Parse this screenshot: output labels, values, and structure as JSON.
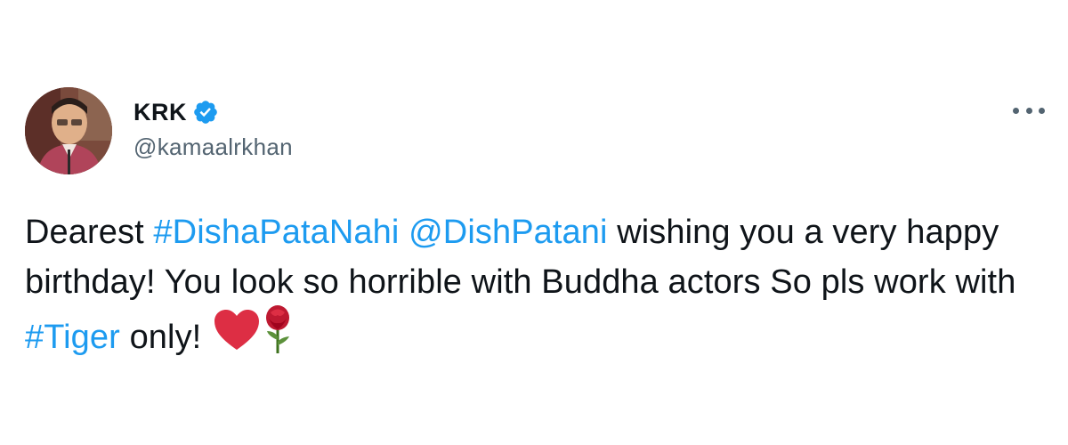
{
  "tweet": {
    "author": {
      "display_name": "KRK",
      "handle": "@kamaalrkhan",
      "verified": true
    },
    "body": {
      "text_1": "Dearest ",
      "hashtag_1": "#DishaPataNahi",
      "space_1": " ",
      "mention_1": "@DishPatani",
      "text_2": " wishing you a very happy birthday! You look so horrible with Buddha actors So pls work with ",
      "hashtag_2": "#Tiger",
      "text_3": " only! ",
      "emojis": [
        "red-heart",
        "rose"
      ]
    }
  },
  "colors": {
    "link": "#1d9bf0",
    "verified": "#1d9bf0",
    "secondary_text": "#536471",
    "primary_text": "#0f1419"
  }
}
